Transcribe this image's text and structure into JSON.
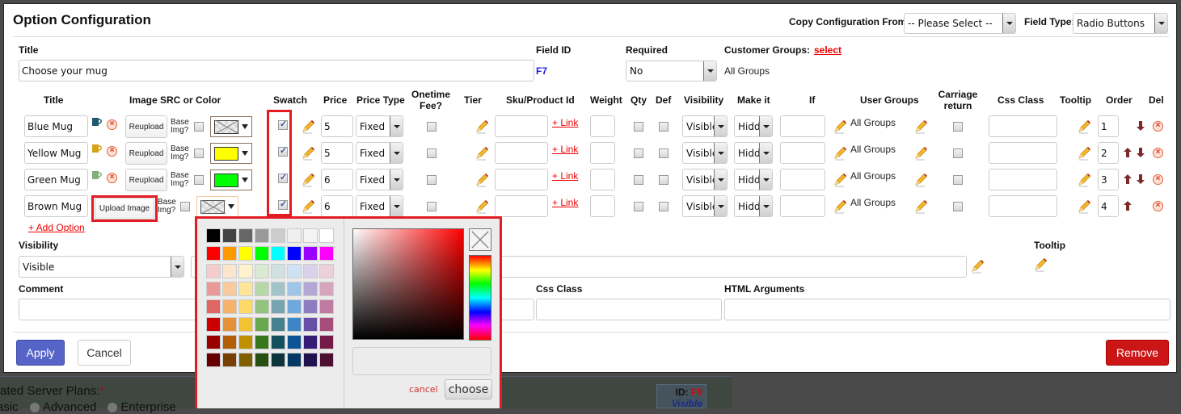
{
  "modal": {
    "title": "Option Configuration",
    "copy_config_label": "Copy Configuration From:",
    "copy_config_value": "-- Please Select --",
    "field_type_label": "Field Type:",
    "field_type_value": "Radio Buttons"
  },
  "fields": {
    "title_label": "Title",
    "title_value": "Choose your mug",
    "field_id_label": "Field ID",
    "field_id_value": "F7",
    "required_label": "Required",
    "required_value": "No",
    "customer_groups_label": "Customer Groups:",
    "customer_groups_link": "select",
    "customer_groups_value": "All Groups"
  },
  "table": {
    "headers": {
      "title": "Title",
      "image": "Image SRC or Color",
      "swatch": "Swatch",
      "price": "Price",
      "price_type": "Price Type",
      "onetime1": "Onetime",
      "onetime2": "Fee?",
      "tier": "Tier",
      "sku": "Sku/Product Id",
      "weight": "Weight",
      "qty": "Qty",
      "def": "Def",
      "visibility": "Visibility",
      "make_it": "Make it",
      "if": "If",
      "user_groups": "User Groups",
      "carriage1": "Carriage",
      "carriage2": "return",
      "css_class": "Css Class",
      "tooltip": "Tooltip",
      "order": "Order",
      "del": "Del"
    },
    "base_img_label1": "Base",
    "base_img_label2": "Img?",
    "link_label": "+ Link",
    "rows": [
      {
        "title": "Blue Mug",
        "mug_color": "#1f5a6e",
        "upload": "Reupload",
        "color": "none",
        "swatch": true,
        "price": "5",
        "price_type": "Fixed",
        "visibility": "Visible",
        "make_it": "Hidd",
        "user_groups": "All Groups",
        "order": "1",
        "up": false,
        "down": true
      },
      {
        "title": "Yellow Mug",
        "mug_color": "#d4a21a",
        "upload": "Reupload",
        "color": "#ffff00",
        "swatch": true,
        "price": "5",
        "price_type": "Fixed",
        "visibility": "Visible",
        "make_it": "Hidd",
        "user_groups": "All Groups",
        "order": "2",
        "up": true,
        "down": true
      },
      {
        "title": "Green Mug",
        "mug_color": "#7fb07a",
        "upload": "Reupload",
        "color": "#00ff00",
        "swatch": true,
        "price": "6",
        "price_type": "Fixed",
        "visibility": "Visible",
        "make_it": "Hidd",
        "user_groups": "All Groups",
        "order": "3",
        "up": true,
        "down": true
      },
      {
        "title": "Brown Mug",
        "mug_color": null,
        "upload": "Upload Image",
        "color": "none",
        "swatch": true,
        "price": "6",
        "price_type": "Fixed",
        "visibility": "Visible",
        "make_it": "Hidd",
        "user_groups": "All Groups",
        "order": "4",
        "up": true,
        "down": false
      }
    ],
    "add_option": "+ Add Option"
  },
  "bottom": {
    "visibility_label": "Visibility",
    "visibility_value": "Visible",
    "tooltip_label": "Tooltip",
    "comment_label": "Comment",
    "css_class_label": "Css Class",
    "html_args_label": "HTML Arguments"
  },
  "buttons": {
    "apply": "Apply",
    "cancel": "Cancel",
    "remove": "Remove"
  },
  "color_picker": {
    "palette": [
      [
        "#000000",
        "#434343",
        "#666666",
        "#999999",
        "#cccccc",
        "#efefef",
        "#f3f3f3",
        "#ffffff"
      ],
      [
        "#ff0000",
        "#ff9900",
        "#ffff00",
        "#00ff00",
        "#00ffff",
        "#0000ff",
        "#9900ff",
        "#ff00ff"
      ],
      [
        "#f4cccc",
        "#fce5cd",
        "#fff2cc",
        "#d9ead3",
        "#d0e0e3",
        "#cfe2f3",
        "#d9d2e9",
        "#ead1dc"
      ],
      [
        "#ea9999",
        "#f9cb9c",
        "#ffe599",
        "#b6d7a8",
        "#a2c4c9",
        "#9fc5e8",
        "#b4a7d6",
        "#d5a6bd"
      ],
      [
        "#e06666",
        "#f6b26b",
        "#ffd966",
        "#93c47d",
        "#76a5af",
        "#6fa8dc",
        "#8e7cc3",
        "#c27ba0"
      ],
      [
        "#cc0000",
        "#e69138",
        "#f1c232",
        "#6aa84f",
        "#45818e",
        "#3d85c6",
        "#674ea7",
        "#a64d79"
      ],
      [
        "#990000",
        "#b45f06",
        "#bf9000",
        "#38761d",
        "#134f5c",
        "#0b5394",
        "#351c75",
        "#741b47"
      ],
      [
        "#660000",
        "#783f04",
        "#7f6000",
        "#274e13",
        "#0c343d",
        "#073763",
        "#20124d",
        "#4c1130"
      ]
    ],
    "cancel": "cancel",
    "choose": "choose"
  },
  "background": {
    "plans_label": "ated Server Plans:",
    "required_mark": "*",
    "radio_options": [
      "asic",
      "Advanced",
      "Enterprise"
    ],
    "id_label": "ID:",
    "id_value": "F9",
    "visible_label": "Visible"
  }
}
